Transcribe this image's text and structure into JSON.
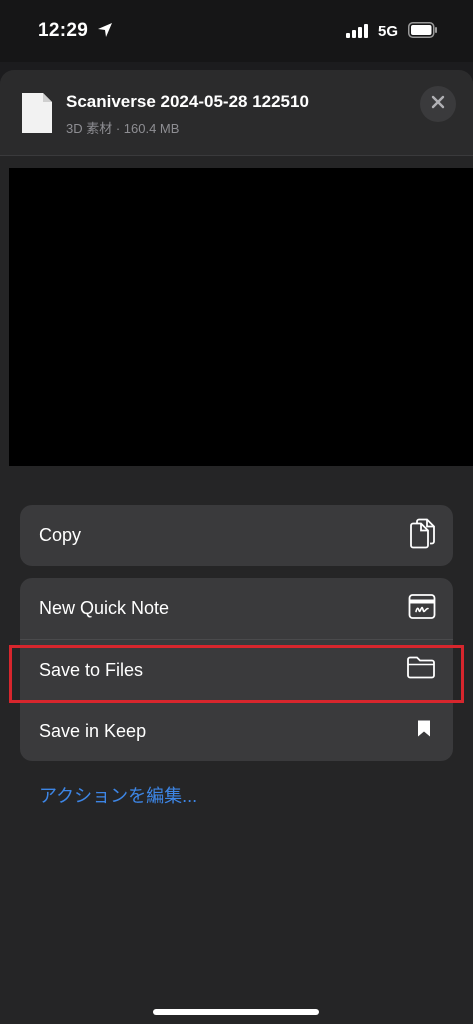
{
  "status_bar": {
    "time": "12:29",
    "network": "5G",
    "icons": [
      "location-arrow-icon",
      "signal-bars-icon",
      "battery-icon"
    ]
  },
  "header": {
    "title": "Scaniverse 2024-05-28 122510",
    "subtitle": "3D 素材 · 160.4 MB",
    "file_icon": "document-icon",
    "close_icon": "close-icon"
  },
  "actions": {
    "group1": [
      {
        "label": "Copy",
        "icon": "copy-icon"
      }
    ],
    "group2": [
      {
        "label": "New Quick Note",
        "icon": "quick-note-icon"
      },
      {
        "label": "Save to Files",
        "icon": "folder-icon"
      },
      {
        "label": "Save in Keep",
        "icon": "bookmark-icon"
      }
    ],
    "edit_link": "アクションを編集..."
  },
  "colors": {
    "background": "#1c1c1e",
    "sheet": "#252526",
    "row": "#3a3a3c",
    "link": "#3d86e6",
    "highlight": "#d7262d"
  }
}
